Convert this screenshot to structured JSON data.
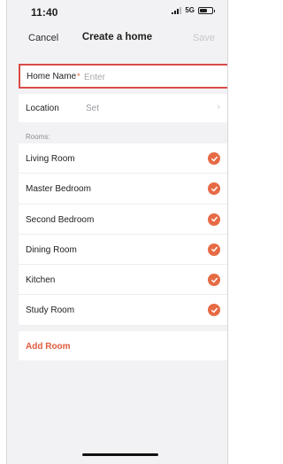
{
  "status_bar": {
    "time": "11:40",
    "network": "5G"
  },
  "nav": {
    "cancel_label": "Cancel",
    "title": "Create a home",
    "save_label": "Save"
  },
  "form": {
    "home_name_label": "Home Name",
    "home_name_required_mark": "*",
    "home_name_placeholder": "Enter",
    "home_name_value": "",
    "location_label": "Location",
    "location_value": "Set"
  },
  "rooms": {
    "section_label": "Rooms:",
    "items": [
      {
        "label": "Living Room",
        "checked": true
      },
      {
        "label": "Master Bedroom",
        "checked": true
      },
      {
        "label": "Second Bedroom",
        "checked": true
      },
      {
        "label": "Dining Room",
        "checked": true
      },
      {
        "label": "Kitchen",
        "checked": true
      },
      {
        "label": "Study Room",
        "checked": true
      }
    ],
    "add_room_label": "Add Room"
  },
  "icons": {
    "signal": "signal-strength-icon",
    "battery": "battery-icon",
    "chevron": "chevron-right-icon",
    "check": "checkmark-circle-icon"
  },
  "colors": {
    "accent": "#e66b45",
    "highlight_border": "#d94a4a",
    "disabled_text": "#c7c7cc"
  }
}
